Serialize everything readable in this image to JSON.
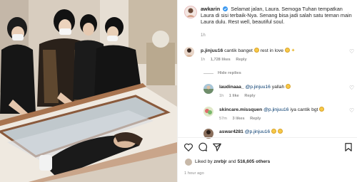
{
  "post": {
    "owner": "awkarin",
    "caption_text": "Selamat jalan, Laura. Semoga Tuhan tempatkan Laura di sisi terbaik-Nya. Senang bisa jadi salah satu teman main Laura dulu. Rest well, beautiful soul.",
    "caption_time": "1h"
  },
  "comments": [
    {
      "user": "p.jinjuu16",
      "text": "cantik banget",
      "text2": "rest in love",
      "time": "1h",
      "likes": "1,728 likes",
      "reply": "Reply"
    }
  ],
  "hide_replies": "Hide replies",
  "replies": [
    {
      "user": "laudinaaa_",
      "mention": "@p.jinjuu16",
      "text": "yallah",
      "time": "1h",
      "likes": "1 like",
      "reply": "Reply"
    },
    {
      "user": "skincare.missquen",
      "mention": "@p.jinjuu16",
      "text": "iya cantik bgt",
      "time": "57m",
      "likes": "3 likes",
      "reply": "Reply"
    },
    {
      "user": "aswar4281",
      "mention": "@p.jinjuu16",
      "text": "",
      "time": "",
      "likes": "",
      "reply": ""
    }
  ],
  "likes_summary": {
    "prefix": "Liked by",
    "user": "znrbjr",
    "middle": "and",
    "others": "516,605 others"
  },
  "post_date": "1 hour ago",
  "icons": {
    "verified": "verified-badge-icon",
    "like": "heart-icon",
    "comment": "comment-icon",
    "share": "share-icon",
    "save": "bookmark-icon"
  },
  "colors": {
    "verified": "#3897f0",
    "mention": "#00376b",
    "muted": "#8e8e8e"
  }
}
